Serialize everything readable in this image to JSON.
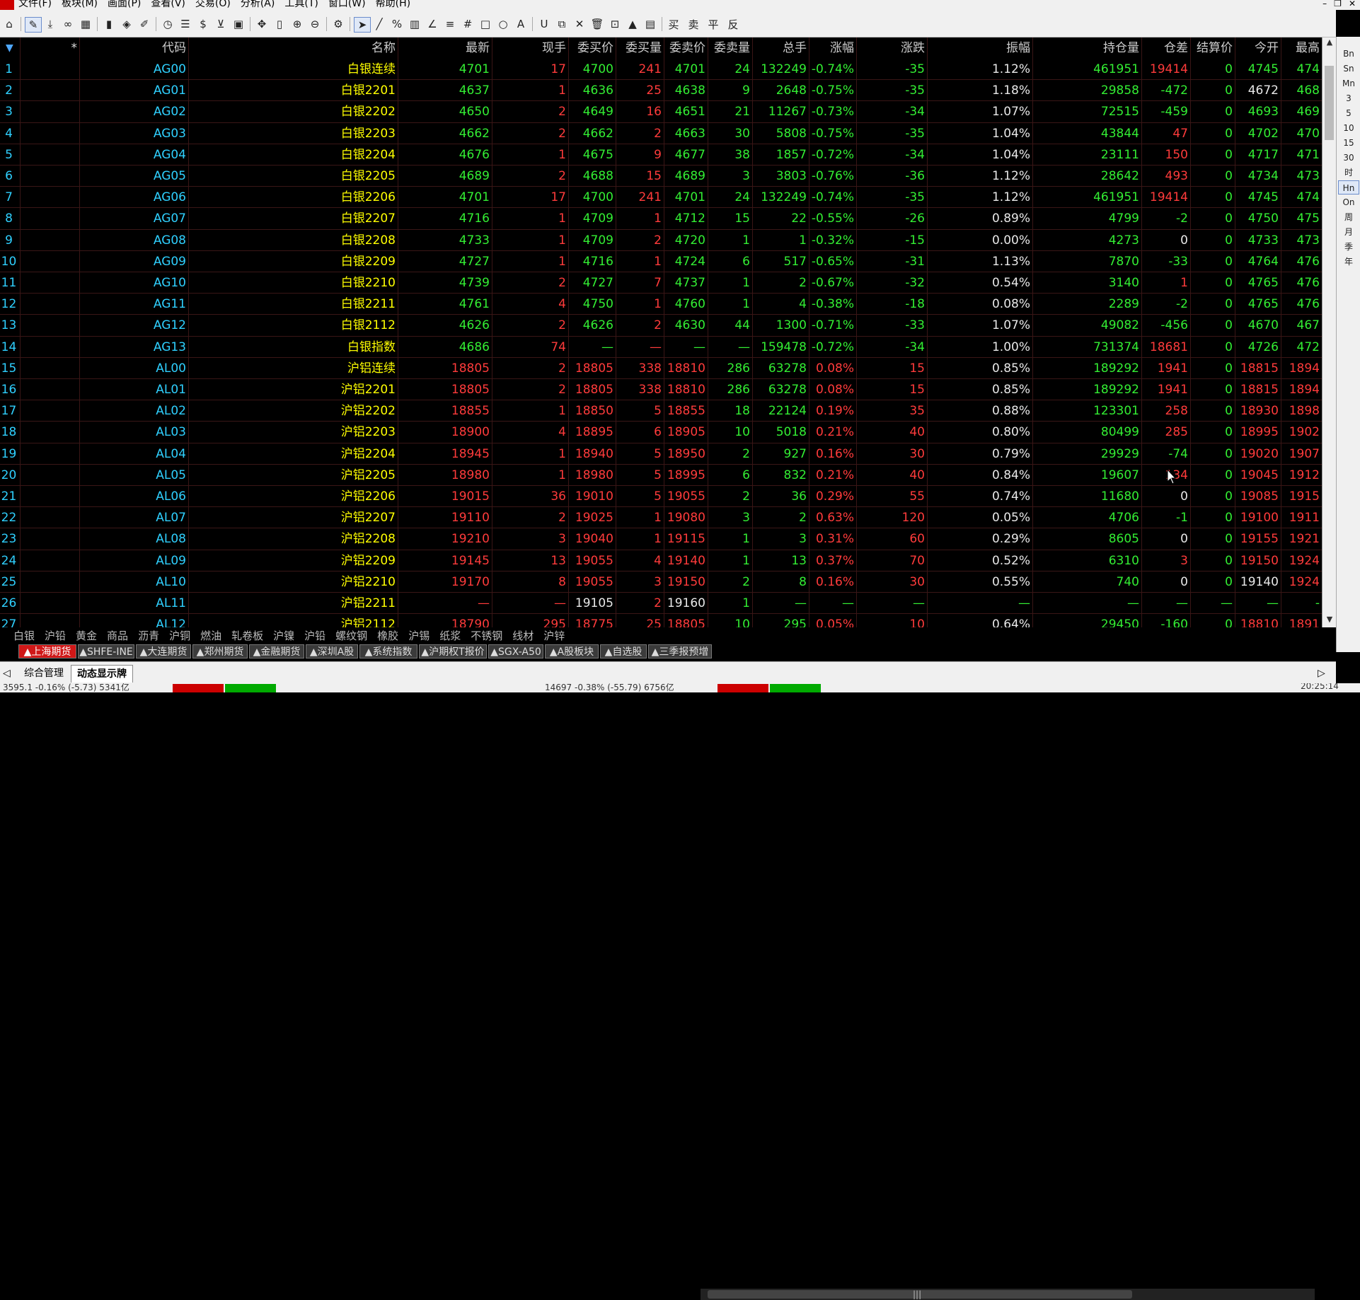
{
  "menubar": {
    "items": [
      "文件(F)",
      "板块(M)",
      "画面(P)",
      "查看(V)",
      "交易(O)",
      "分析(A)",
      "工具(T)",
      "窗口(W)",
      "帮助(H)"
    ]
  },
  "toolbar": {
    "icons": [
      "home-icon",
      "pen-icon",
      "download-icon",
      "link-icon",
      "layout-icon",
      "bar-chart-icon",
      "diamond-icon",
      "edit-icon",
      "clock-icon",
      "list-icon",
      "dollar-icon",
      "filter-icon",
      "window-icon",
      "move-icon",
      "ruler-icon",
      "zoom-in-icon",
      "zoom-out-icon",
      "gear-icon",
      "cursor-icon",
      "line-icon",
      "percent-icon",
      "grid-icon",
      "angle-icon",
      "parallel-icon",
      "hash-icon",
      "rect-icon",
      "circle-icon",
      "text-icon",
      "magnet-icon",
      "copy-icon",
      "close-icon",
      "trash-icon",
      "lock-icon",
      "color-icon",
      "save-icon",
      "buy-icon",
      "sell-icon",
      "flat-icon",
      "reverse-icon"
    ]
  },
  "columns": [
    "*",
    "代码",
    "名称",
    "最新",
    "现手",
    "委买价",
    "委买量",
    "委卖价",
    "委卖量",
    "总手",
    "涨幅",
    "涨跌",
    "振幅",
    "持仓量",
    "仓差",
    "结算价",
    "今开",
    "最高"
  ],
  "rows": [
    {
      "n": "1",
      "code": "AG00",
      "name": "白银连续",
      "last": "4701",
      "vol": "17",
      "bid": "4700",
      "bidv": "241",
      "ask": "4701",
      "askv": "24",
      "total": "132249",
      "pct": "-0.74%",
      "chg": "-35",
      "amp": "1.12%",
      "oi": "461951",
      "oid": "19414",
      "settle": "0",
      "open": "4745",
      "high": "474"
    },
    {
      "n": "2",
      "code": "AG01",
      "name": "白银2201",
      "last": "4637",
      "vol": "1",
      "bid": "4636",
      "bidv": "25",
      "ask": "4638",
      "askv": "9",
      "total": "2648",
      "pct": "-0.75%",
      "chg": "-35",
      "amp": "1.18%",
      "oi": "29858",
      "oid": "-472",
      "settle": "0",
      "open": "4672",
      "high": "468"
    },
    {
      "n": "3",
      "code": "AG02",
      "name": "白银2202",
      "last": "4650",
      "vol": "2",
      "bid": "4649",
      "bidv": "16",
      "ask": "4651",
      "askv": "21",
      "total": "11267",
      "pct": "-0.73%",
      "chg": "-34",
      "amp": "1.07%",
      "oi": "72515",
      "oid": "-459",
      "settle": "0",
      "open": "4693",
      "high": "469"
    },
    {
      "n": "4",
      "code": "AG03",
      "name": "白银2203",
      "last": "4662",
      "vol": "2",
      "bid": "4662",
      "bidv": "2",
      "ask": "4663",
      "askv": "30",
      "total": "5808",
      "pct": "-0.75%",
      "chg": "-35",
      "amp": "1.04%",
      "oi": "43844",
      "oid": "47",
      "settle": "0",
      "open": "4702",
      "high": "470"
    },
    {
      "n": "5",
      "code": "AG04",
      "name": "白银2204",
      "last": "4676",
      "vol": "1",
      "bid": "4675",
      "bidv": "9",
      "ask": "4677",
      "askv": "38",
      "total": "1857",
      "pct": "-0.72%",
      "chg": "-34",
      "amp": "1.04%",
      "oi": "23111",
      "oid": "150",
      "settle": "0",
      "open": "4717",
      "high": "471"
    },
    {
      "n": "6",
      "code": "AG05",
      "name": "白银2205",
      "last": "4689",
      "vol": "2",
      "bid": "4688",
      "bidv": "15",
      "ask": "4689",
      "askv": "3",
      "total": "3803",
      "pct": "-0.76%",
      "chg": "-36",
      "amp": "1.12%",
      "oi": "28642",
      "oid": "493",
      "settle": "0",
      "open": "4734",
      "high": "473"
    },
    {
      "n": "7",
      "code": "AG06",
      "name": "白银2206",
      "last": "4701",
      "vol": "17",
      "bid": "4700",
      "bidv": "241",
      "ask": "4701",
      "askv": "24",
      "total": "132249",
      "pct": "-0.74%",
      "chg": "-35",
      "amp": "1.12%",
      "oi": "461951",
      "oid": "19414",
      "settle": "0",
      "open": "4745",
      "high": "474"
    },
    {
      "n": "8",
      "code": "AG07",
      "name": "白银2207",
      "last": "4716",
      "vol": "1",
      "bid": "4709",
      "bidv": "1",
      "ask": "4712",
      "askv": "15",
      "total": "22",
      "pct": "-0.55%",
      "chg": "-26",
      "amp": "0.89%",
      "oi": "4799",
      "oid": "-2",
      "settle": "0",
      "open": "4750",
      "high": "475"
    },
    {
      "n": "9",
      "code": "AG08",
      "name": "白银2208",
      "last": "4733",
      "vol": "1",
      "bid": "4709",
      "bidv": "2",
      "ask": "4720",
      "askv": "1",
      "total": "1",
      "pct": "-0.32%",
      "chg": "-15",
      "amp": "0.00%",
      "oi": "4273",
      "oid": "0",
      "settle": "0",
      "open": "4733",
      "high": "473"
    },
    {
      "n": "10",
      "code": "AG09",
      "name": "白银2209",
      "last": "4727",
      "vol": "1",
      "bid": "4716",
      "bidv": "1",
      "ask": "4724",
      "askv": "6",
      "total": "517",
      "pct": "-0.65%",
      "chg": "-31",
      "amp": "1.13%",
      "oi": "7870",
      "oid": "-33",
      "settle": "0",
      "open": "4764",
      "high": "476"
    },
    {
      "n": "11",
      "code": "AG10",
      "name": "白银2210",
      "last": "4739",
      "vol": "2",
      "bid": "4727",
      "bidv": "7",
      "ask": "4737",
      "askv": "1",
      "total": "2",
      "pct": "-0.67%",
      "chg": "-32",
      "amp": "0.54%",
      "oi": "3140",
      "oid": "1",
      "settle": "0",
      "open": "4765",
      "high": "476"
    },
    {
      "n": "12",
      "code": "AG11",
      "name": "白银2211",
      "last": "4761",
      "vol": "4",
      "bid": "4750",
      "bidv": "1",
      "ask": "4760",
      "askv": "1",
      "total": "4",
      "pct": "-0.38%",
      "chg": "-18",
      "amp": "0.08%",
      "oi": "2289",
      "oid": "-2",
      "settle": "0",
      "open": "4765",
      "high": "476"
    },
    {
      "n": "13",
      "code": "AG12",
      "name": "白银2112",
      "last": "4626",
      "vol": "2",
      "bid": "4626",
      "bidv": "2",
      "ask": "4630",
      "askv": "44",
      "total": "1300",
      "pct": "-0.71%",
      "chg": "-33",
      "amp": "1.07%",
      "oi": "49082",
      "oid": "-456",
      "settle": "0",
      "open": "4670",
      "high": "467"
    },
    {
      "n": "14",
      "code": "AG13",
      "name": "白银指数",
      "last": "4686",
      "vol": "74",
      "bid": "—",
      "bidv": "—",
      "ask": "—",
      "askv": "—",
      "total": "159478",
      "pct": "-0.72%",
      "chg": "-34",
      "amp": "1.00%",
      "oi": "731374",
      "oid": "18681",
      "settle": "0",
      "open": "4726",
      "high": "472"
    },
    {
      "n": "15",
      "code": "AL00",
      "name": "沪铝连续",
      "last": "18805",
      "vol": "2",
      "bid": "18805",
      "bidv": "338",
      "ask": "18810",
      "askv": "286",
      "total": "63278",
      "pct": "0.08%",
      "chg": "15",
      "amp": "0.85%",
      "oi": "189292",
      "oid": "1941",
      "settle": "0",
      "open": "18815",
      "high": "1894"
    },
    {
      "n": "16",
      "code": "AL01",
      "name": "沪铝2201",
      "last": "18805",
      "vol": "2",
      "bid": "18805",
      "bidv": "338",
      "ask": "18810",
      "askv": "286",
      "total": "63278",
      "pct": "0.08%",
      "chg": "15",
      "amp": "0.85%",
      "oi": "189292",
      "oid": "1941",
      "settle": "0",
      "open": "18815",
      "high": "1894"
    },
    {
      "n": "17",
      "code": "AL02",
      "name": "沪铝2202",
      "last": "18855",
      "vol": "1",
      "bid": "18850",
      "bidv": "5",
      "ask": "18855",
      "askv": "18",
      "total": "22124",
      "pct": "0.19%",
      "chg": "35",
      "amp": "0.88%",
      "oi": "123301",
      "oid": "258",
      "settle": "0",
      "open": "18930",
      "high": "1898"
    },
    {
      "n": "18",
      "code": "AL03",
      "name": "沪铝2203",
      "last": "18900",
      "vol": "4",
      "bid": "18895",
      "bidv": "6",
      "ask": "18905",
      "askv": "10",
      "total": "5018",
      "pct": "0.21%",
      "chg": "40",
      "amp": "0.80%",
      "oi": "80499",
      "oid": "285",
      "settle": "0",
      "open": "18995",
      "high": "1902"
    },
    {
      "n": "19",
      "code": "AL04",
      "name": "沪铝2204",
      "last": "18945",
      "vol": "1",
      "bid": "18940",
      "bidv": "5",
      "ask": "18950",
      "askv": "2",
      "total": "927",
      "pct": "0.16%",
      "chg": "30",
      "amp": "0.79%",
      "oi": "29929",
      "oid": "-74",
      "settle": "0",
      "open": "19020",
      "high": "1907"
    },
    {
      "n": "20",
      "code": "AL05",
      "name": "沪铝2205",
      "last": "18980",
      "vol": "1",
      "bid": "18980",
      "bidv": "5",
      "ask": "18995",
      "askv": "6",
      "total": "832",
      "pct": "0.21%",
      "chg": "40",
      "amp": "0.84%",
      "oi": "19607",
      "oid": "134",
      "settle": "0",
      "open": "19045",
      "high": "1912"
    },
    {
      "n": "21",
      "code": "AL06",
      "name": "沪铝2206",
      "last": "19015",
      "vol": "36",
      "bid": "19010",
      "bidv": "5",
      "ask": "19055",
      "askv": "2",
      "total": "36",
      "pct": "0.29%",
      "chg": "55",
      "amp": "0.74%",
      "oi": "11680",
      "oid": "0",
      "settle": "0",
      "open": "19085",
      "high": "1915"
    },
    {
      "n": "22",
      "code": "AL07",
      "name": "沪铝2207",
      "last": "19110",
      "vol": "2",
      "bid": "19025",
      "bidv": "1",
      "ask": "19080",
      "askv": "3",
      "total": "2",
      "pct": "0.63%",
      "chg": "120",
      "amp": "0.05%",
      "oi": "4706",
      "oid": "-1",
      "settle": "0",
      "open": "19100",
      "high": "1911"
    },
    {
      "n": "23",
      "code": "AL08",
      "name": "沪铝2208",
      "last": "19210",
      "vol": "3",
      "bid": "19040",
      "bidv": "1",
      "ask": "19115",
      "askv": "1",
      "total": "3",
      "pct": "0.31%",
      "chg": "60",
      "amp": "0.29%",
      "oi": "8605",
      "oid": "0",
      "settle": "0",
      "open": "19155",
      "high": "1921"
    },
    {
      "n": "24",
      "code": "AL09",
      "name": "沪铝2209",
      "last": "19145",
      "vol": "13",
      "bid": "19055",
      "bidv": "4",
      "ask": "19140",
      "askv": "1",
      "total": "13",
      "pct": "0.37%",
      "chg": "70",
      "amp": "0.52%",
      "oi": "6310",
      "oid": "3",
      "settle": "0",
      "open": "19150",
      "high": "1924"
    },
    {
      "n": "25",
      "code": "AL10",
      "name": "沪铝2210",
      "last": "19170",
      "vol": "8",
      "bid": "19055",
      "bidv": "3",
      "ask": "19150",
      "askv": "2",
      "total": "8",
      "pct": "0.16%",
      "chg": "30",
      "amp": "0.55%",
      "oi": "740",
      "oid": "0",
      "settle": "0",
      "open": "19140",
      "high": "1924"
    },
    {
      "n": "26",
      "code": "AL11",
      "name": "沪铝2211",
      "last": "—",
      "vol": "—",
      "bid": "19105",
      "bidv": "2",
      "ask": "19160",
      "askv": "1",
      "total": "—",
      "pct": "—",
      "chg": "—",
      "amp": "—",
      "oi": "—",
      "oid": "—",
      "settle": "—",
      "open": "—",
      "high": "-"
    },
    {
      "n": "27",
      "code": "AL12",
      "name": "沪铝2112",
      "last": "18790",
      "vol": "295",
      "bid": "18775",
      "bidv": "25",
      "ask": "18805",
      "askv": "10",
      "total": "295",
      "pct": "0.05%",
      "chg": "10",
      "amp": "0.64%",
      "oi": "29450",
      "oid": "-160",
      "settle": "0",
      "open": "18810",
      "high": "1891"
    }
  ],
  "categories": [
    "白银",
    "沪铅",
    "黄金",
    "商品",
    "沥青",
    "沪铜",
    "燃油",
    "轧卷板",
    "沪镍",
    "沪铅",
    "螺纹钢",
    "橡胶",
    "沪锡",
    "纸浆",
    "不锈钢",
    "线材",
    "沪锌"
  ],
  "market_tabs": [
    "▲上海期货",
    "▲SHFE-INE",
    "▲大连期货",
    "▲郑州期货",
    "▲金融期货",
    "▲深圳A股",
    "▲系统指数",
    "▲沪期权T报价",
    "▲SGX-A50",
    "▲A股板块",
    "▲自选股",
    "▲三季报预增"
  ],
  "hscroll_grip": "|||",
  "workspace_tabs": [
    "综合管理",
    "动态显示牌"
  ],
  "right_toolbar": [
    "Bn",
    "Sn",
    "Mn",
    "3",
    "5",
    "10",
    "15",
    "30",
    "时",
    "Hn",
    "On",
    "周",
    "月",
    "季",
    "年"
  ],
  "status": {
    "left": "3595.1 -0.16% (-5.73) 5341亿",
    "mid": "14697 -0.38% (-55.79) 6756亿",
    "time": "20:25:14"
  },
  "colors": {
    "up": "#ff3b3b",
    "down": "#33ee33",
    "code": "#2fd0ff",
    "name": "#ffff00",
    "active_tab": "#d01818"
  }
}
